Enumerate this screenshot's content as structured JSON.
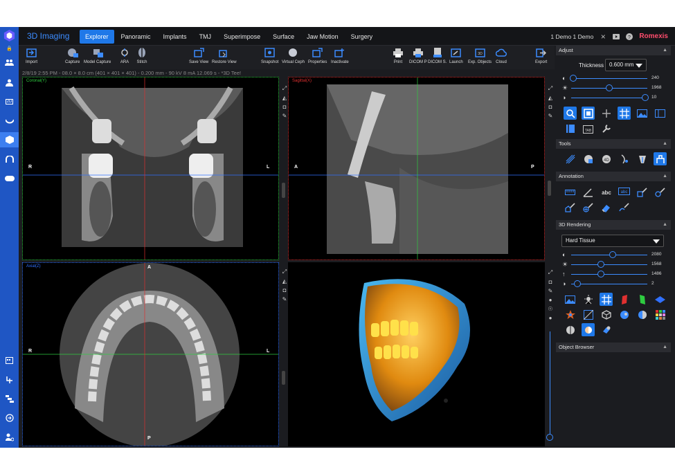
{
  "nav": {
    "brand": "3D Imaging",
    "tabs": [
      "Explorer",
      "Panoramic",
      "Implants",
      "TMJ",
      "Superimpose",
      "Surface",
      "Jaw Motion",
      "Surgery"
    ],
    "user": "1 Demo 1 Demo",
    "logo": "Romexis"
  },
  "toolbar": {
    "import": "Import",
    "capture": "Capture",
    "model_capture": "Model Capture",
    "ara": "ARA",
    "stitch": "Stitch",
    "save_view": "Save View",
    "restore_view": "Restore View",
    "snapshot": "Snapshot",
    "virtual_ceph": "Virtual Ceph",
    "properties": "Properties",
    "inactivate": "Inactivate",
    "print": "Print",
    "dicom_p": "DICOM P",
    "dicom_s": "DICOM S.",
    "launch": "Launch",
    "exp_objects": "Exp. Objects",
    "cloud": "Cloud",
    "export": "Export"
  },
  "status": "2/8/19 2:55 PM - 08.0 × 8.0 cm (401 × 401 × 401) - 0.200 mm - 90 kV 8 mA 12.069 s - *3D Tee!",
  "views": {
    "coronal": {
      "label": "Coronal(Y)",
      "left": "R",
      "right": "L"
    },
    "sagittal": {
      "label": "Sagittal(X)",
      "left": "A",
      "right": "P"
    },
    "axial": {
      "label": "Axial(Z)",
      "top": "A",
      "bottom": "P",
      "left": "R",
      "right": "L"
    }
  },
  "panel": {
    "adjust": {
      "title": "Adjust",
      "thickness_label": "Thickness",
      "thickness_value": "0.600 mm",
      "sliders": [
        {
          "icon": "contrast-icon",
          "value": "240",
          "pos": 0.0
        },
        {
          "icon": "brightness-icon",
          "value": "1968",
          "pos": 0.5
        },
        {
          "icon": "gamma-icon",
          "value": "10",
          "pos": 1.0
        }
      ]
    },
    "tools": {
      "title": "Tools"
    },
    "annotation": {
      "title": "Annotation"
    },
    "rendering": {
      "title": "3D Rendering",
      "preset": "Hard Tissue",
      "sliders": [
        {
          "icon": "contrast-icon",
          "value": "2080",
          "pos": 0.55
        },
        {
          "icon": "brightness-icon",
          "value": "1568",
          "pos": 0.38
        },
        {
          "icon": "arrow-up-icon",
          "value": "1486",
          "pos": 0.38
        },
        {
          "icon": "gamma-icon",
          "value": "2",
          "pos": 0.06
        }
      ]
    },
    "object_browser": {
      "title": "Object Browser"
    }
  },
  "colors": {
    "accent": "#1f78e8",
    "sidebar": "#1f56c4",
    "coronal": "#2ecc40",
    "sagittal": "#e03030",
    "axial": "#3070ff"
  }
}
